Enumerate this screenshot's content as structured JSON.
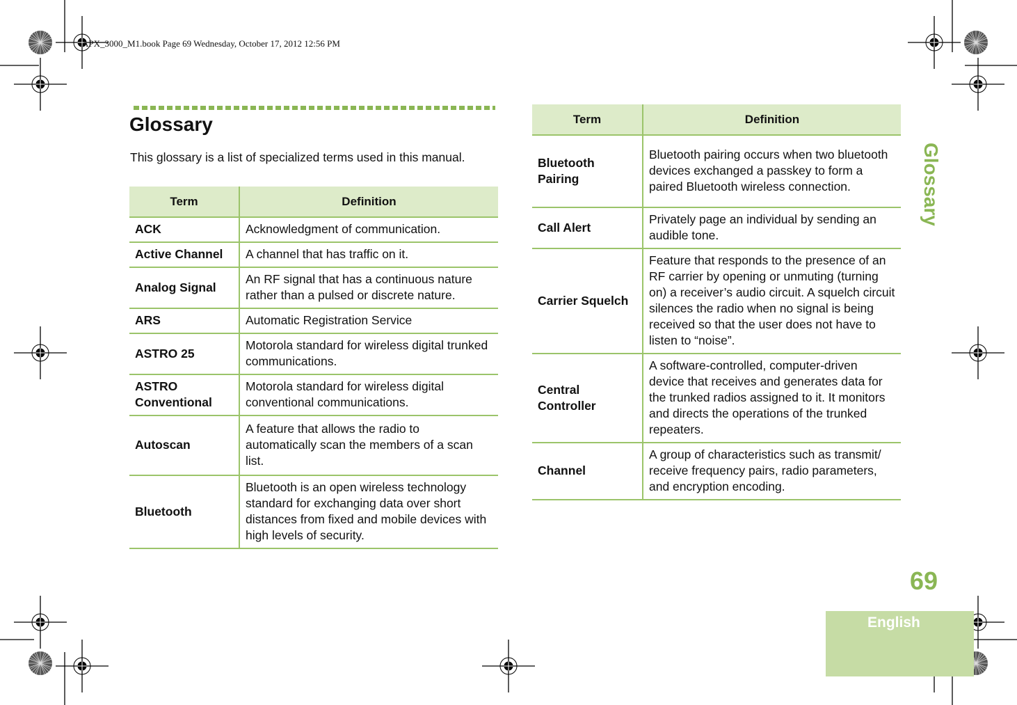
{
  "running_header": "APX_3000_M1.book  Page 69  Wednesday, October 17, 2012  12:56 PM",
  "section": {
    "title": "Glossary",
    "intro": "This glossary is a list of specialized terms used in this manual."
  },
  "tables": {
    "left": {
      "headers": [
        "Term",
        "Definition"
      ],
      "rows": [
        {
          "term": "ACK",
          "definition": "Acknowledgment of communication."
        },
        {
          "term": "Active Channel",
          "definition": "A channel that has traffic on it."
        },
        {
          "term": "Analog Signal",
          "definition": "An RF signal that has a continuous nature rather than a pulsed or discrete nature."
        },
        {
          "term": "ARS",
          "definition": "Automatic Registration Service"
        },
        {
          "term": "ASTRO 25",
          "definition": "Motorola standard for wireless digital trunked communications."
        },
        {
          "term": "ASTRO Conventional",
          "definition": "Motorola standard for wireless digital conventional communications."
        },
        {
          "term": "Autoscan",
          "definition": "A feature that allows the radio to automatically scan the members of a scan list."
        },
        {
          "term": "Bluetooth",
          "definition": "Bluetooth is an open wireless technology standard for exchanging data over short distances from fixed and mobile devices with high levels of security."
        }
      ]
    },
    "right": {
      "headers": [
        "Term",
        "Definition"
      ],
      "rows": [
        {
          "term": "Bluetooth Pairing",
          "definition": "Bluetooth pairing occurs when two bluetooth devices exchanged a passkey to form a paired Bluetooth wireless connection."
        },
        {
          "term": "Call Alert",
          "definition": "Privately page an individual by sending an audible tone."
        },
        {
          "term": "Carrier Squelch",
          "definition": "Feature that responds to the presence of an RF carrier by opening or unmuting (turning on) a receiver’s audio circuit. A squelch circuit silences the radio when no signal is being received so that the user does not have to listen to “noise”."
        },
        {
          "term": "Central Controller",
          "definition": "A software-controlled, computer-driven device that receives and generates data for the trunked radios assigned to it. It monitors and directs the operations of the trunked repeaters."
        },
        {
          "term": "Channel",
          "definition": "A group of characteristics such as transmit/ receive frequency pairs, radio parameters, and encryption encoding."
        }
      ]
    }
  },
  "side_tab": {
    "chapter": "Glossary",
    "page_number": "69",
    "language": "English"
  },
  "colors": {
    "accent_green": "#8ab654",
    "header_fill": "#ddebc9",
    "language_tab_fill": "#c6dca5",
    "rule_green": "#9bc46a"
  }
}
